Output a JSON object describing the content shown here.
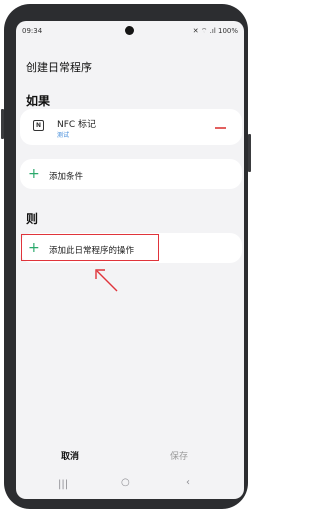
{
  "status_bar": {
    "time": "09:34",
    "indicators": "✕ ⌔ .ıl 100%"
  },
  "page": {
    "title": "创建日常程序"
  },
  "if_section": {
    "heading": "如果",
    "condition": {
      "icon": "nfc-icon",
      "icon_glyph": "N",
      "name": "NFC 标记",
      "subtitle": "测试"
    },
    "add_condition_label": "添加条件"
  },
  "then_section": {
    "heading": "则",
    "add_action_label": "添加此日常程序的操作"
  },
  "bottom_actions": {
    "cancel": "取消",
    "save": "保存"
  },
  "nav_bar": {
    "recents": "|||",
    "home": "○",
    "back": "‹"
  },
  "colors": {
    "accent_green": "#2aa96b",
    "remove_red": "#e2605f",
    "highlight_red": "#e0343b",
    "subtitle_blue": "#3a86d8"
  }
}
